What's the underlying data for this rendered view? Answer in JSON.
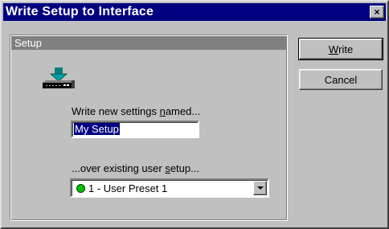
{
  "window": {
    "title": "Write Setup to Interface",
    "close_glyph": "×"
  },
  "setup_group": {
    "header": "Setup",
    "icon": "device-write-icon",
    "name_label_pre": "Write new settings ",
    "name_label_ul": "n",
    "name_label_post": "amed...",
    "name_value": "My Setup",
    "over_label_pre": "...over existing user ",
    "over_label_ul": "s",
    "over_label_post": "etup...",
    "preset_value": "1 - User Preset 1",
    "preset_status_color": "#00c000"
  },
  "buttons": {
    "write_ul": "W",
    "write_rest": "rite",
    "cancel": "Cancel"
  }
}
